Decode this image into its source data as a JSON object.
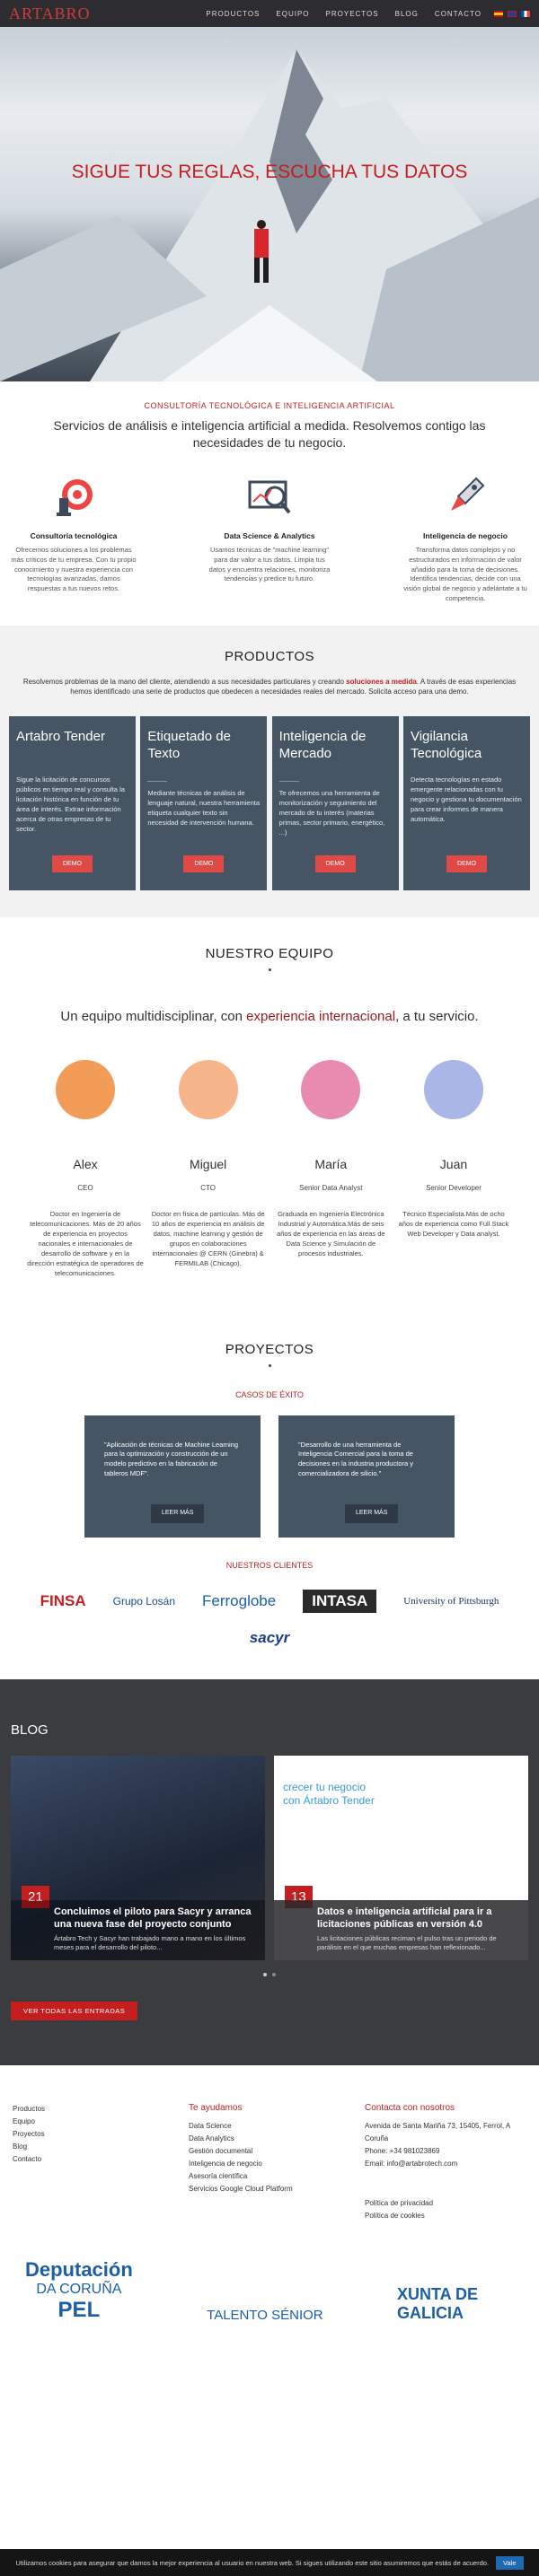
{
  "brand": "ARTABRO",
  "nav": {
    "items": [
      "PRODUCTOS",
      "EQUIPO",
      "PROYECTOS",
      "BLOG",
      "CONTACTO"
    ]
  },
  "hero": {
    "title": "SIGUE TUS REGLAS, ESCUCHA TUS DATOS"
  },
  "intro": {
    "subtitle": "CONSULTORÍA TECNOLÓGICA E INTELIGENCIA ARTIFICIAL",
    "text": "Servicios de análisis e inteligencia artificial a medida. Resolvemos contigo las necesidades de tu negocio."
  },
  "services": [
    {
      "title": "Consultoría tecnológica",
      "text": "Ofrecemos soluciones a los problemas más críticos de tu empresa. Con tu propio conocimiento y nuestra experiencia con tecnologías avanzadas, damos respuestas a tus nuevos retos."
    },
    {
      "title": "Data Science & Analytics",
      "text": "Usamos técnicas de \"machine learning\" para dar valor a tus datos. Limpia tus datos y encuentra relaciones, monitoriza tendencias y predice tu futuro."
    },
    {
      "title": "Inteligencia de negocio",
      "text": "Transforma datos complejos y no estructurados en información de valor añadido para la toma de decisiones. Identifica tendencias, decide con una visión global de negocio y adelántate a tu competencia."
    }
  ],
  "products": {
    "title": "PRODUCTOS",
    "intro_a": "Resolvemos problemas de la mano del cliente, atendiendo a sus necesidades particulares y creando",
    "intro_b": "soluciones a medida",
    "intro_c": ". A través de esas experiencias hemos identificado una serie de productos que obedecen a necesidades reales del mercado. Solicita acceso para una demo.",
    "cards": [
      {
        "title": "Artabro Tender",
        "text": "Sigue la licitación de concursos públicos en tiempo real y consulta la licitación histórica en función de tu área de interés. Extrae información acerca de otras empresas de tu sector.",
        "button": "DEMO"
      },
      {
        "title": "Etiquetado de Texto",
        "text": "Mediante técnicas de análisis de lenguaje natural, nuestra herramienta etiqueta cualquier texto sin necesidad de intervención humana.",
        "button": "DEMO"
      },
      {
        "title": "Inteligencia de Mercado",
        "text": "Te ofrecemos una herramienta de monitorización y seguimiento del mercado de tu interés (materias primas, sector primario, energético, ...)",
        "button": "DEMO"
      },
      {
        "title": "Vigilancia Tecnológica",
        "text": "Detecta tecnologías en estado emergente relacionadas con tu negocio y gestiona tu documentación para crear informes de manera automática.",
        "button": "DEMO"
      }
    ]
  },
  "team": {
    "title": "NUESTRO EQUIPO",
    "sub_a": "Un equipo multidisciplinar, con ",
    "sub_b": "experiencia internacional",
    "sub_c": ", a tu servicio.",
    "members": [
      {
        "name": "Alex",
        "role": "CEO",
        "bio": "Doctor en Ingeniería de telecomunicaciones. Más de 20 años de experiencia en proyectos nacionales e internacionales de desarrollo de software y en la dirección estratégica de operadores de telecomunicaciones.",
        "color": "#f39c57"
      },
      {
        "name": "Miguel",
        "role": "CTO",
        "bio": "Doctor en física de partículas. Más de 10 años de experiencia en análisis de datos, machine learning y gestión de grupos en colaboraciones internacionales @ CERN (Ginebra) & FERMILAB (Chicago).",
        "color": "#f5b48a"
      },
      {
        "name": "María",
        "role": "Senior Data Analyst",
        "bio": "Graduada en Ingeniería Electrónica Industrial y Automática.Más de seis años de experiencia en las áreas de Data Science y Simulación de procesos industriales.",
        "color": "#e98bb0"
      },
      {
        "name": "Juan",
        "role": "Senior Developer",
        "bio": "Técnico Especialista.Más de ocho años de experiencia como Full Stack Web Developer y Data analyst.",
        "color": "#a9b6e6"
      }
    ]
  },
  "projects": {
    "title": "PROYECTOS",
    "cases_title": "CASOS DE ÉXITO",
    "cases": [
      {
        "text": "\"Aplicación de técnicas de Machine Learning para la optimización y construcción de un modelo predictivo en la fabricación de tableros MDF\".",
        "button": "LEER MÁS"
      },
      {
        "text": "\"Desarrollo de una herramienta de Inteligencia Comercial para la toma de decisiones en la industria productora y comercializadora de silicio.\"",
        "button": "LEER MÁS"
      }
    ],
    "clients_title": "NUESTROS CLIENTES",
    "clients": [
      "FINSA",
      "Grupo Losán",
      "Ferroglobe",
      "INTASA",
      "University of Pittsburgh",
      "sacyr"
    ]
  },
  "blog": {
    "title": "BLOG",
    "posts": [
      {
        "day": "21",
        "month": "ABR",
        "title": "Concluimos el piloto para Sacyr y arranca una nueva fase del proyecto conjunto",
        "excerpt": "Ártabro Tech y Sacyr han trabajado mano a mano en los últimos meses para el desarrollo del piloto..."
      },
      {
        "day": "13",
        "month": "ABR",
        "title": "Datos e inteligencia artificial para ir a licitaciones públicas en versión 4.0",
        "excerpt": "Las licitaciones públicas reciman el pulso tras un periodo de parálisis en el que muchas empresas han reflexionado..."
      }
    ],
    "slide_text": "crecer tu negocio con Ártabro Tender",
    "see_all": "VER TODAS LAS ENTRADAS"
  },
  "footer": {
    "col1": [
      "Productos",
      "Equipo",
      "Proyectos",
      "Blog",
      "Contacto"
    ],
    "col2_title": "Te ayudamos",
    "col2": [
      "Data Science",
      "Data Analytics",
      "Gestión documental",
      "Inteligencia de negocio",
      "Asesoría científica",
      "Servicios Google Cloud Platform"
    ],
    "col3_title": "Contacta con nosotros",
    "col3": [
      "Avenida de Santa Mariña 73, 15405, Ferrol, A Coruña",
      "Phone: +34 981023869",
      "Email: info@artabrotech.com"
    ],
    "legal": [
      "Política de privacidad",
      "Política de cookies"
    ],
    "sponsor_a1": "Deputación",
    "sponsor_a2": "DA CORUÑA",
    "sponsor_pel": "PEL",
    "sponsor_talent": "TALENTO SÉNIOR",
    "sponsor_xunta": "XUNTA DE GALICIA"
  },
  "cookie": {
    "text": "Utilizamos cookies para asegurar que damos la mejor experiencia al usuario en nuestra web. Si sigues utilizando este sitio asumiremos que estás de acuerdo.",
    "ok": "Vale"
  }
}
